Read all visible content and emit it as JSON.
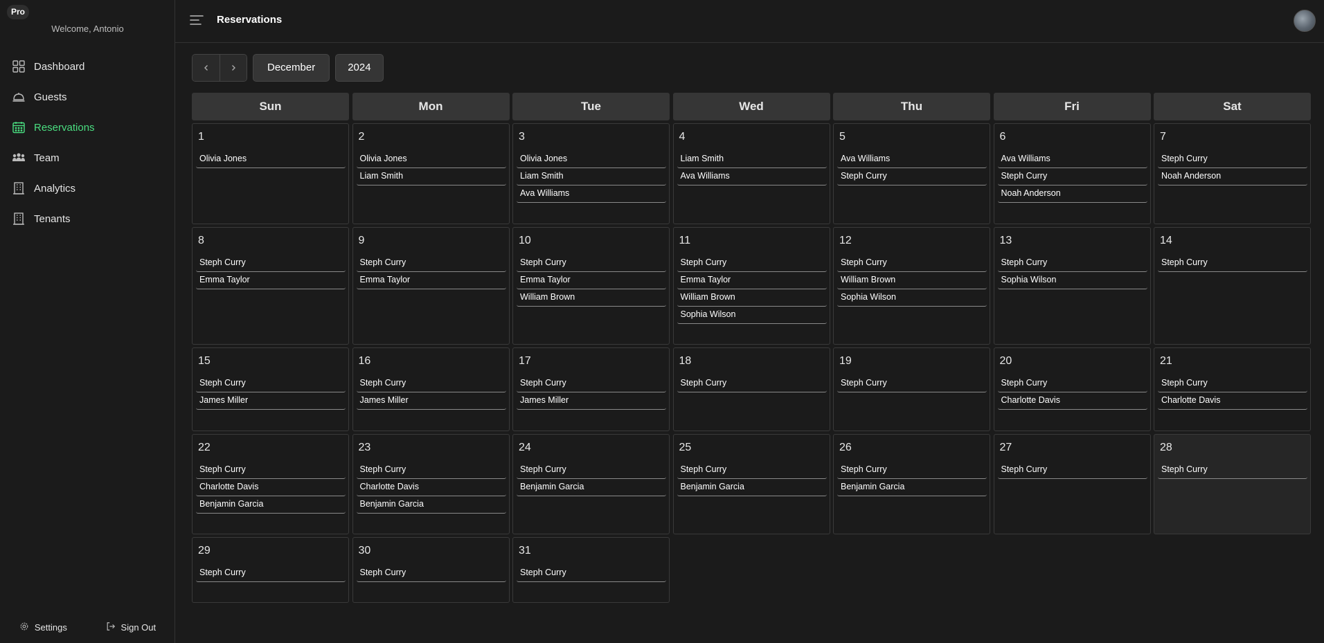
{
  "app": {
    "badge": "Pro",
    "welcome": "Welcome, Antonio"
  },
  "sidebar": {
    "items": [
      {
        "label": "Dashboard",
        "icon": "dashboard-grid-icon",
        "active": false
      },
      {
        "label": "Guests",
        "icon": "cloche-icon",
        "active": false
      },
      {
        "label": "Reservations",
        "icon": "calendar-icon",
        "active": true
      },
      {
        "label": "Team",
        "icon": "team-icon",
        "active": false
      },
      {
        "label": "Analytics",
        "icon": "building-icon",
        "active": false
      },
      {
        "label": "Tenants",
        "icon": "building-icon",
        "active": false
      }
    ],
    "settings": "Settings",
    "sign_out": "Sign Out"
  },
  "header": {
    "title": "Reservations"
  },
  "controls": {
    "month": "December",
    "year": "2024"
  },
  "colors": {
    "accent": "#4ade80",
    "background": "#1b1b1b",
    "weekday_bg": "#363636"
  },
  "calendar": {
    "weekdays": [
      "Sun",
      "Mon",
      "Tue",
      "Wed",
      "Thu",
      "Fri",
      "Sat"
    ],
    "highlight_day": 28,
    "weeks": [
      [
        {
          "day": "1",
          "events": [
            "Olivia Jones"
          ]
        },
        {
          "day": "2",
          "events": [
            "Olivia Jones",
            "Liam Smith"
          ]
        },
        {
          "day": "3",
          "events": [
            "Olivia Jones",
            "Liam Smith",
            "Ava Williams"
          ]
        },
        {
          "day": "4",
          "events": [
            "Liam Smith",
            "Ava Williams"
          ]
        },
        {
          "day": "5",
          "events": [
            "Ava Williams",
            "Steph Curry"
          ]
        },
        {
          "day": "6",
          "events": [
            "Ava Williams",
            "Steph Curry",
            "Noah Anderson"
          ]
        },
        {
          "day": "7",
          "events": [
            "Steph Curry",
            "Noah Anderson"
          ]
        }
      ],
      [
        {
          "day": "8",
          "events": [
            "Steph Curry",
            "Emma Taylor"
          ]
        },
        {
          "day": "9",
          "events": [
            "Steph Curry",
            "Emma Taylor"
          ]
        },
        {
          "day": "10",
          "events": [
            "Steph Curry",
            "Emma Taylor",
            "William Brown"
          ]
        },
        {
          "day": "11",
          "events": [
            "Steph Curry",
            "Emma Taylor",
            "William Brown",
            "Sophia Wilson"
          ]
        },
        {
          "day": "12",
          "events": [
            "Steph Curry",
            "William Brown",
            "Sophia Wilson"
          ]
        },
        {
          "day": "13",
          "events": [
            "Steph Curry",
            "Sophia Wilson"
          ]
        },
        {
          "day": "14",
          "events": [
            "Steph Curry"
          ]
        }
      ],
      [
        {
          "day": "15",
          "events": [
            "Steph Curry",
            "James Miller"
          ]
        },
        {
          "day": "16",
          "events": [
            "Steph Curry",
            "James Miller"
          ]
        },
        {
          "day": "17",
          "events": [
            "Steph Curry",
            "James Miller"
          ]
        },
        {
          "day": "18",
          "events": [
            "Steph Curry"
          ]
        },
        {
          "day": "19",
          "events": [
            "Steph Curry"
          ]
        },
        {
          "day": "20",
          "events": [
            "Steph Curry",
            "Charlotte Davis"
          ]
        },
        {
          "day": "21",
          "events": [
            "Steph Curry",
            "Charlotte Davis"
          ]
        }
      ],
      [
        {
          "day": "22",
          "events": [
            "Steph Curry",
            "Charlotte Davis",
            "Benjamin Garcia"
          ]
        },
        {
          "day": "23",
          "events": [
            "Steph Curry",
            "Charlotte Davis",
            "Benjamin Garcia"
          ]
        },
        {
          "day": "24",
          "events": [
            "Steph Curry",
            "Benjamin Garcia"
          ]
        },
        {
          "day": "25",
          "events": [
            "Steph Curry",
            "Benjamin Garcia"
          ]
        },
        {
          "day": "26",
          "events": [
            "Steph Curry",
            "Benjamin Garcia"
          ]
        },
        {
          "day": "27",
          "events": [
            "Steph Curry"
          ]
        },
        {
          "day": "28",
          "events": [
            "Steph Curry"
          ]
        }
      ],
      [
        {
          "day": "29",
          "events": [
            "Steph Curry"
          ]
        },
        {
          "day": "30",
          "events": [
            "Steph Curry"
          ]
        },
        {
          "day": "31",
          "events": [
            "Steph Curry"
          ]
        },
        null,
        null,
        null,
        null
      ]
    ]
  }
}
